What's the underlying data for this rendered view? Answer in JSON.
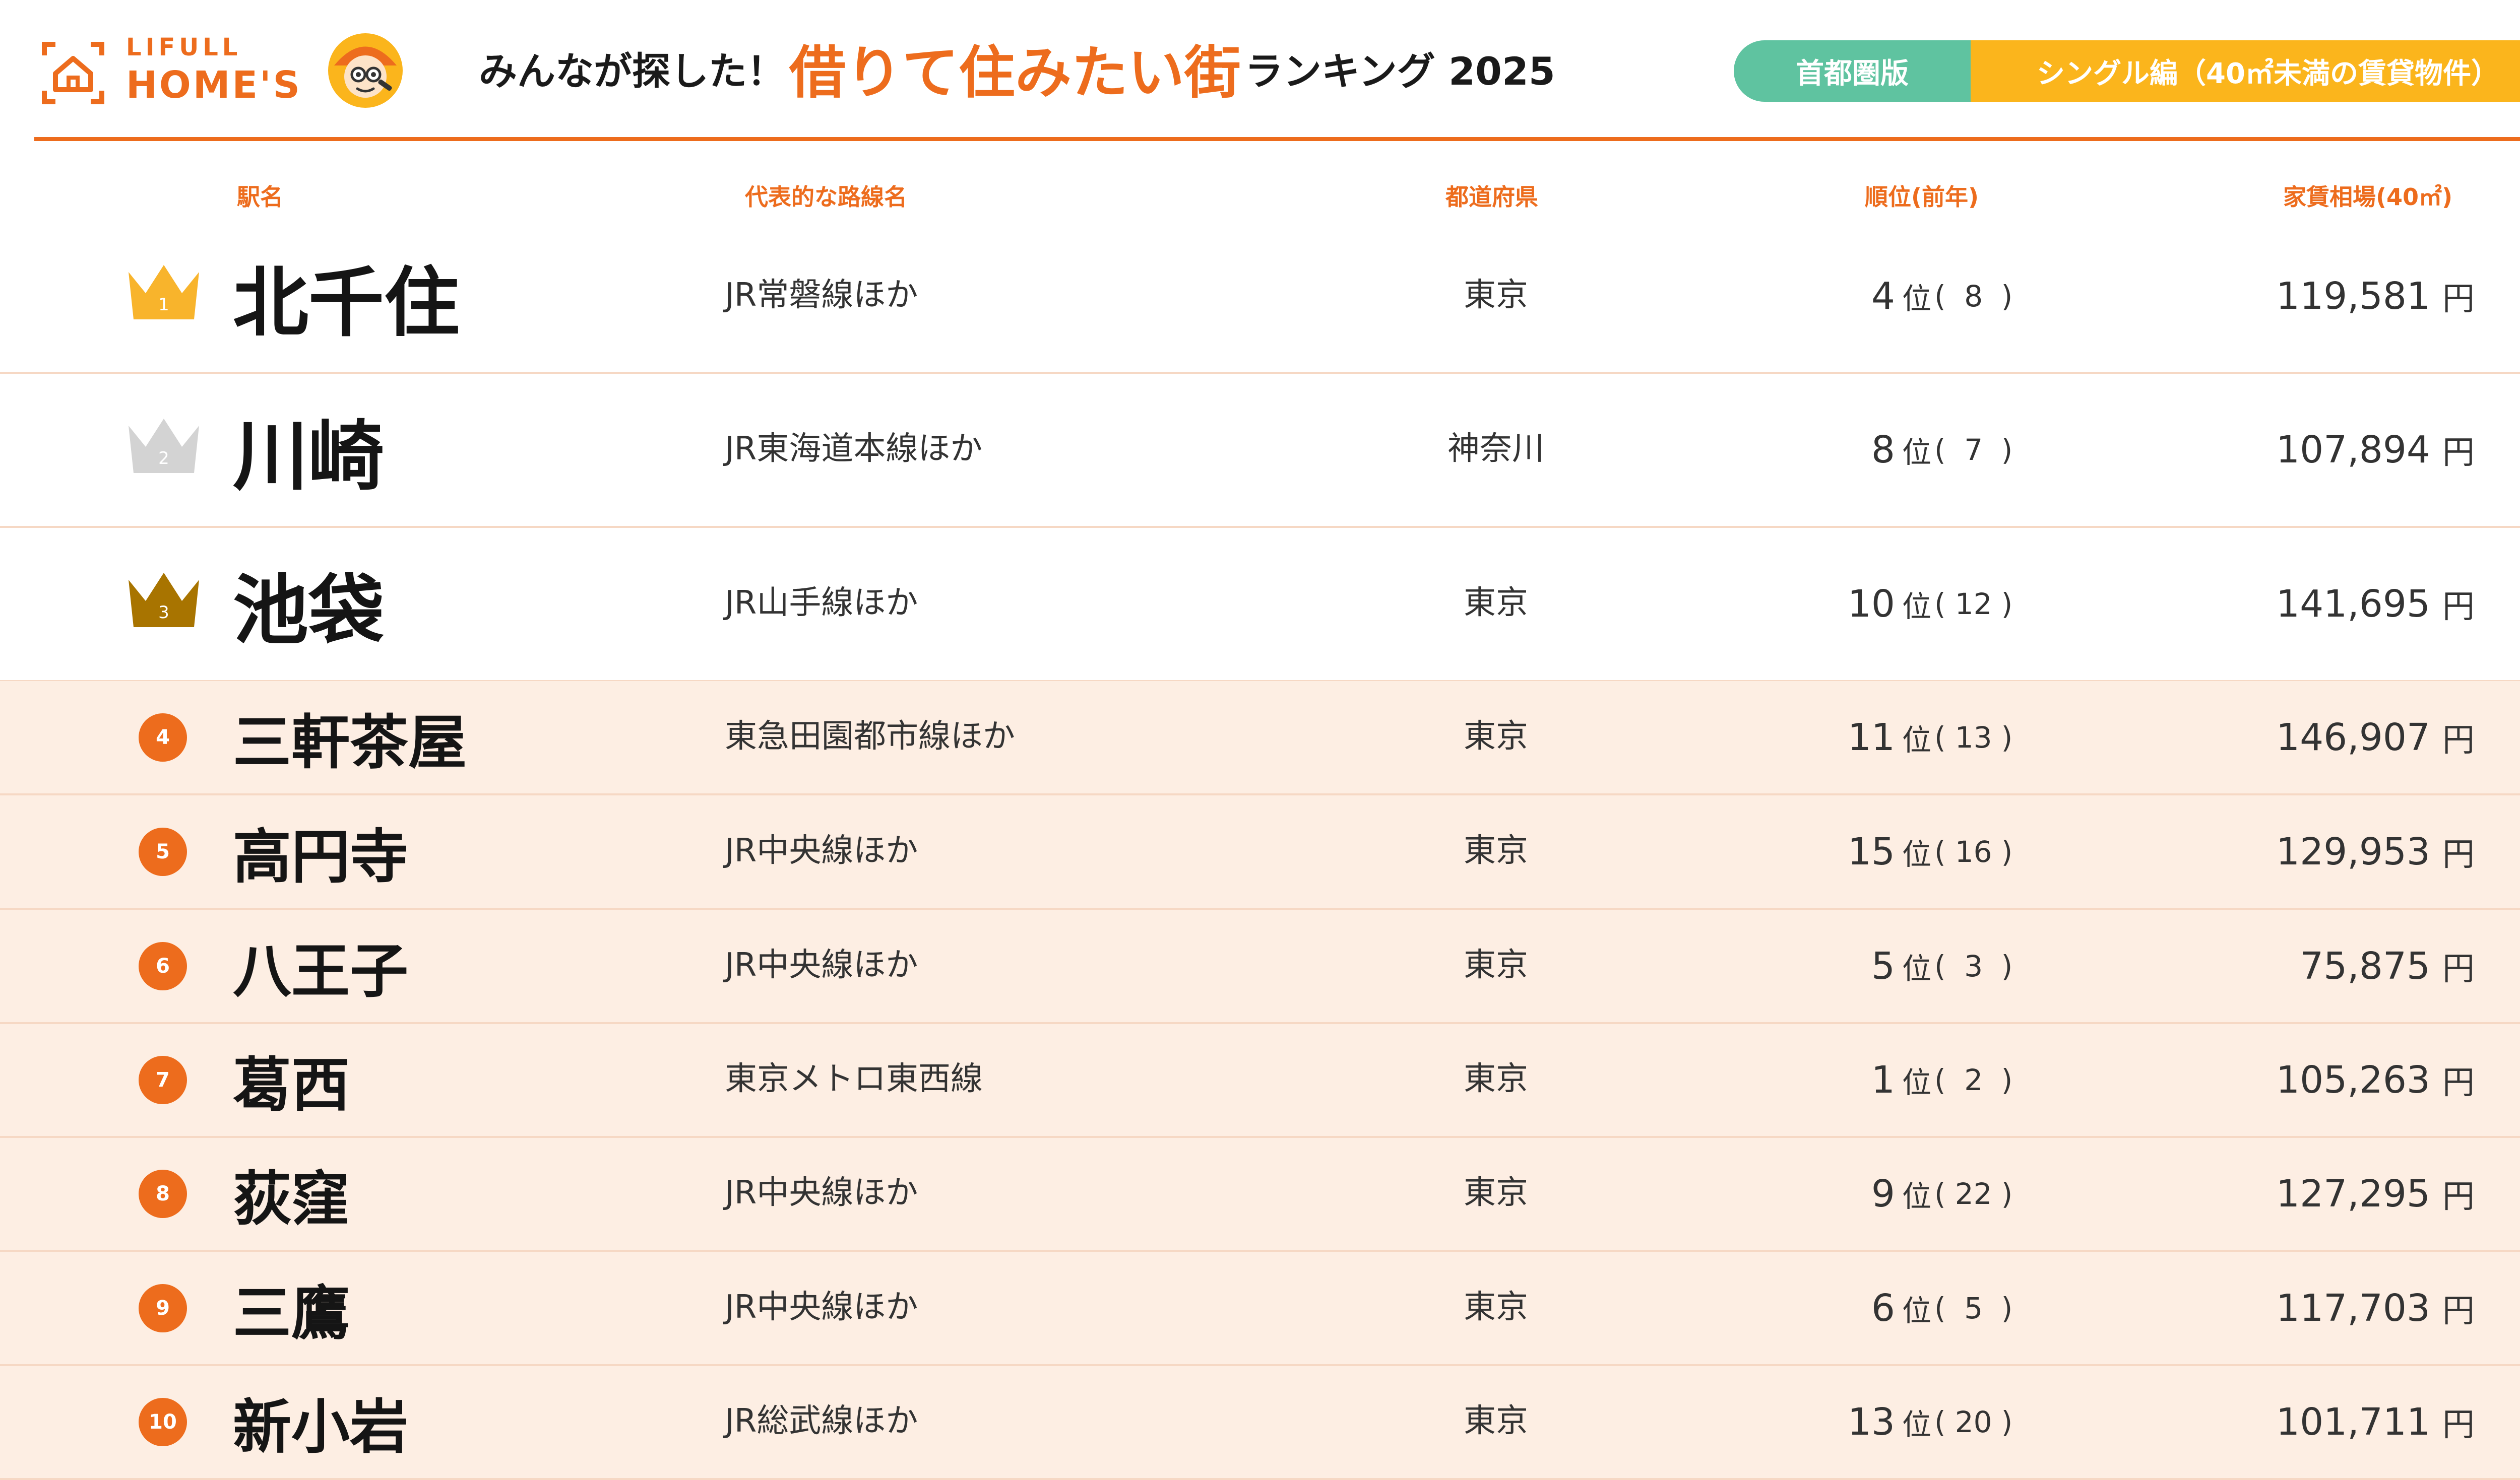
{
  "brand": {
    "line1": "LIFULL",
    "line2": "HOME'S"
  },
  "title": {
    "prefix": "みんなが探した！",
    "main": "借りて住みたい街",
    "suffix": "ランキング 2025"
  },
  "tags": {
    "region": "首都圏版",
    "category": "シングル編（40㎡未満の賃貸物件）"
  },
  "columns": {
    "station": "駅名",
    "line": "代表的な路線名",
    "prefecture": "都道府県",
    "rank": "順位(前年)",
    "rent": "家賃相場(40㎡)"
  },
  "units": {
    "rank": "位",
    "open": "(",
    "close": ")",
    "yen": "円"
  },
  "colors": {
    "accent": "#ed6c1d",
    "teal": "#5fc3a0",
    "yellow": "#fbb51c",
    "gold": "#f8b42c",
    "silver": "#d3d3d3",
    "bronze": "#a87400",
    "row_tint": "#fdeee3"
  },
  "rows": [
    {
      "pos": "1",
      "icon": "gold-crown-icon",
      "station": "北千住",
      "line": "JR常磐線ほか",
      "prefecture": "東京",
      "rank": "4",
      "prev": "8",
      "rent": "119,581"
    },
    {
      "pos": "2",
      "icon": "silver-crown-icon",
      "station": "川崎",
      "line": "JR東海道本線ほか",
      "prefecture": "神奈川",
      "rank": "8",
      "prev": "7",
      "rent": "107,894"
    },
    {
      "pos": "3",
      "icon": "bronze-crown-icon",
      "station": "池袋",
      "line": "JR山手線ほか",
      "prefecture": "東京",
      "rank": "10",
      "prev": "12",
      "rent": "141,695"
    },
    {
      "pos": "4",
      "station": "三軒茶屋",
      "line": "東急田園都市線ほか",
      "prefecture": "東京",
      "rank": "11",
      "prev": "13",
      "rent": "146,907"
    },
    {
      "pos": "5",
      "station": "高円寺",
      "line": "JR中央線ほか",
      "prefecture": "東京",
      "rank": "15",
      "prev": "16",
      "rent": "129,953"
    },
    {
      "pos": "6",
      "station": "八王子",
      "line": "JR中央線ほか",
      "prefecture": "東京",
      "rank": "5",
      "prev": "3",
      "rent": "75,875"
    },
    {
      "pos": "7",
      "station": "葛西",
      "line": "東京メトロ東西線",
      "prefecture": "東京",
      "rank": "1",
      "prev": "2",
      "rent": "105,263"
    },
    {
      "pos": "8",
      "station": "荻窪",
      "line": "JR中央線ほか",
      "prefecture": "東京",
      "rank": "9",
      "prev": "22",
      "rent": "127,295"
    },
    {
      "pos": "9",
      "station": "三鷹",
      "line": "JR中央線ほか",
      "prefecture": "東京",
      "rank": "6",
      "prev": "5",
      "rent": "117,703"
    },
    {
      "pos": "10",
      "station": "新小岩",
      "line": "JR総武線ほか",
      "prefecture": "東京",
      "rank": "13",
      "prev": "20",
      "rent": "101,711"
    }
  ]
}
